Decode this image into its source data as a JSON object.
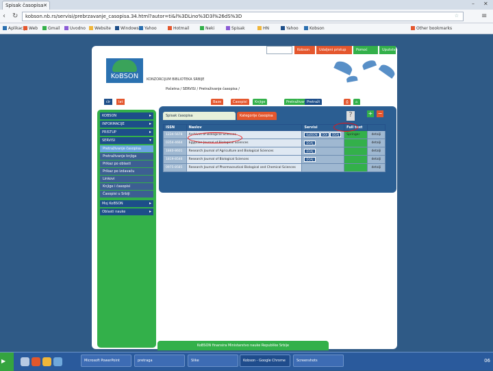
{
  "browser": {
    "tab_title": "Spisak časopisa",
    "url": "kobson.nb.rs/servisi/prebrzavanje_casopisa.34.html?autor=ti&l%3DLino%3D3l%26dS%3D",
    "bookmarks": [
      "Aplikacije",
      "Web",
      "Gmail",
      "Uvodno",
      "Website",
      "Windows",
      "Yahoo",
      "Hotmail",
      "Neki",
      "Spisak",
      "HN",
      "Yahoo",
      "Kobson",
      "Other bookmarks"
    ]
  },
  "site": {
    "top_nav": [
      "Kobson",
      "Udaljeni pristup",
      "Pomoć",
      "Uputstva"
    ],
    "logo_text": "KoBSON",
    "brand_line": "KONZORCIJUM BIBLIOTEKA SRBIJE",
    "breadcrumb": "Početna / SERVISI / Pretraživanje časopisa /",
    "lang_tabs": [
      "ćir",
      "lat"
    ],
    "main_nav": [
      "Baze",
      "Časopisi",
      "Knjige",
      "Pretraživanje",
      "Pretraži"
    ],
    "utility_icons": [
      "print-icon",
      "home-icon"
    ]
  },
  "sidebar": {
    "sections": [
      "KOBSON",
      "INFORMACIJE",
      "PRISTUP",
      "SERVISI"
    ],
    "subitems": [
      "Pretraživanje časopisa",
      "Pretraživanje knjiga",
      "Prikaz po oblasti",
      "Prikaz po izdavaču",
      "Linkovi",
      "Knjige i časopisi",
      "Časopisi u Srbiji"
    ],
    "active_index": 0,
    "after": [
      "Moj KoBSON",
      "Oblasti nauke"
    ]
  },
  "content": {
    "tabs": [
      "Spisak časopisa",
      "Kategorije časopisa"
    ],
    "help_icon": "?",
    "add_label": "+",
    "remove_label": "−",
    "columns": [
      "ISSN",
      "Naslov",
      "Servisi",
      "Full text"
    ],
    "rows": [
      {
        "issn": "1234-5678",
        "title": "Archives of Biological Sciences",
        "servisi": [
          "KoBSON",
          "DOI",
          "DOAJ"
        ],
        "fulltext": "Springer",
        "extra": "detalji"
      },
      {
        "issn": "0354-4664",
        "title": "Egyptian Journal of Biological Sciences",
        "servisi": [
          "DOAJ"
        ],
        "fulltext": "",
        "extra": "detalji"
      },
      {
        "issn": "1840-8601",
        "title": "Research Journal of Agriculture and Biological Sciences",
        "servisi": [
          "DOAJ"
        ],
        "fulltext": "",
        "extra": "detalji"
      },
      {
        "issn": "1819-8546",
        "title": "Research Journal of Biological Sciences",
        "servisi": [
          "DOAJ"
        ],
        "fulltext": "",
        "extra": "detalji"
      },
      {
        "issn": "0975-8585",
        "title": "Research Journal of Pharmaceutical Biological and Chemical Sciences",
        "servisi": [],
        "fulltext": "",
        "extra": "detalji"
      }
    ]
  },
  "footer": {
    "text": "KoBSON finansira Ministarstvo nauke Republike Srbije"
  },
  "taskbar": {
    "items": [
      "Microsoft PowerPoint",
      "pretraga",
      "Slike",
      "Kobson - Google Chrome",
      "Screenshots"
    ],
    "active_index": 3,
    "time": "06"
  },
  "colors": {
    "site_green": "#33b04a",
    "site_blue": "#2b5e92",
    "highlight_red": "#e11111",
    "background": "#2f5a86"
  }
}
